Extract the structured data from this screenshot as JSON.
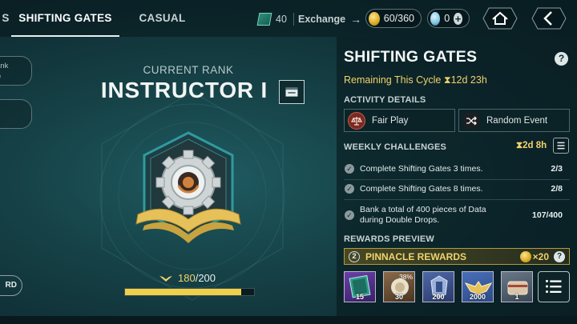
{
  "tabs": [
    {
      "label": "S"
    },
    {
      "label": "SHIFTING GATES",
      "active": true
    },
    {
      "label": "CASUAL"
    }
  ],
  "currencies": {
    "engrams": "40",
    "exchange_label": "Exchange",
    "gold": "60/360",
    "silver": "0"
  },
  "left_remnants": {
    "card1_line1": "ank",
    "card1_line2": "0",
    "card2_line": "e",
    "button": "RD"
  },
  "rank": {
    "caption": "CURRENT RANK",
    "name": "INSTRUCTOR I",
    "progress_current": "180",
    "progress_total": "/200",
    "progress_fraction": 0.9
  },
  "panel": {
    "title": "SHIFTING GATES",
    "help": "?",
    "remaining": "Remaining This Cycle ⧗12d 23h",
    "activity_header": "ACTIVITY DETAILS",
    "activity": [
      "Fair Play",
      "Random Event"
    ],
    "weekly_header": "WEEKLY CHALLENGES",
    "weekly_timer": "⧗2d 8h",
    "challenges": [
      {
        "text": "Complete Shifting Gates 3 times.",
        "progress": "2/3"
      },
      {
        "text": "Complete Shifting Gates 8 times.",
        "progress": "2/8"
      },
      {
        "text": "Bank a total of 400 pieces of Data\nduring Double Drops.",
        "progress": "107/400"
      }
    ],
    "rewards_header": "REWARDS PREVIEW",
    "pinnacle": {
      "num": "2",
      "label": "PINNACLE REWARDS",
      "cost": "×20",
      "help": "?"
    },
    "rewards": [
      {
        "qty": "15",
        "icon": "card-pack-icon",
        "bg": "#4a2f7a"
      },
      {
        "qty": "30",
        "icon": "shard-orb-icon",
        "bg": "#6b4f3a",
        "pct": "38%"
      },
      {
        "qty": "200",
        "icon": "tower-emblem-icon",
        "bg": "#3b4f8a"
      },
      {
        "qty": "2000",
        "icon": "wing-badge-icon",
        "bg": "#3d5a9a"
      },
      {
        "qty": "1",
        "icon": "loot-chest-icon",
        "bg": "#5a6a7a"
      }
    ]
  },
  "colors": {
    "accent_gold": "#f0d36c",
    "panel_bg": "#0c2328",
    "rare_purple": "#4a2f7a"
  }
}
